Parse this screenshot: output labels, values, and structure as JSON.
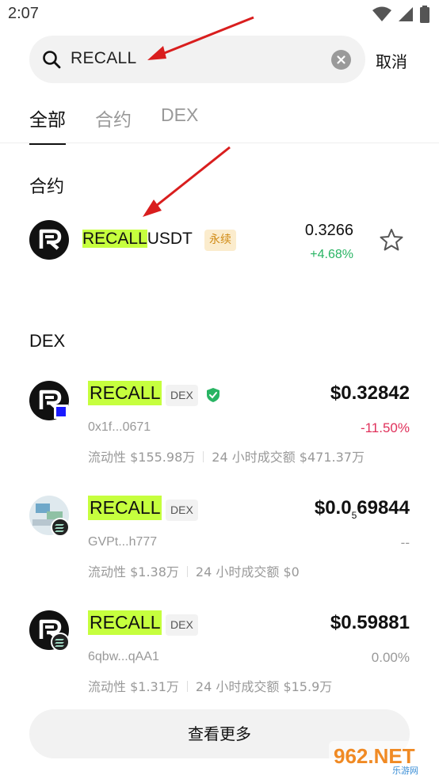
{
  "status_bar": {
    "time": "2:07"
  },
  "search": {
    "query": "RECALL",
    "cancel_label": "取消"
  },
  "tabs": [
    {
      "label": "全部",
      "active": true
    },
    {
      "label": "合约",
      "active": false
    },
    {
      "label": "DEX",
      "active": false
    }
  ],
  "contracts": {
    "title": "合约",
    "items": [
      {
        "symbol_highlight": "RECALL",
        "symbol_rest": "USDT",
        "badge": "永续",
        "price": "0.3266",
        "change": "+4.68%"
      }
    ]
  },
  "dex": {
    "title": "DEX",
    "items": [
      {
        "name": "RECALL",
        "badge": "DEX",
        "verified": true,
        "chain_icon": "blue-square-chain-icon",
        "price": "$0.32842",
        "address": "0x1f...0671",
        "change": "-11.50%",
        "change_color": "#e0315b",
        "liquidity": "流动性 $155.98万",
        "volume": "24 小时成交额 $471.37万"
      },
      {
        "name": "RECALL",
        "badge": "DEX",
        "verified": false,
        "chain_icon": "solana-chain-icon",
        "price_prefix": "$0.0",
        "price_sub": "5",
        "price_suffix": "69844",
        "address": "GVPt...h777",
        "change": "--",
        "change_color": "#999999",
        "liquidity": "流动性 $1.38万",
        "volume": "24 小时成交额 $0"
      },
      {
        "name": "RECALL",
        "badge": "DEX",
        "verified": false,
        "chain_icon": "solana-chain-icon",
        "price": "$0.59881",
        "address": "6qbw...qAA1",
        "change": "0.00%",
        "change_color": "#999999",
        "liquidity": "流动性 $1.31万",
        "volume": "24 小时成交额 $15.9万"
      }
    ]
  },
  "more_label": "查看更多",
  "watermark": {
    "text": "962.NET",
    "subtext": "乐游网"
  },
  "colors": {
    "highlight": "#c6ff3e",
    "positive": "#28b463",
    "negative": "#e0315b",
    "annotation_arrow": "#d91e1e"
  }
}
